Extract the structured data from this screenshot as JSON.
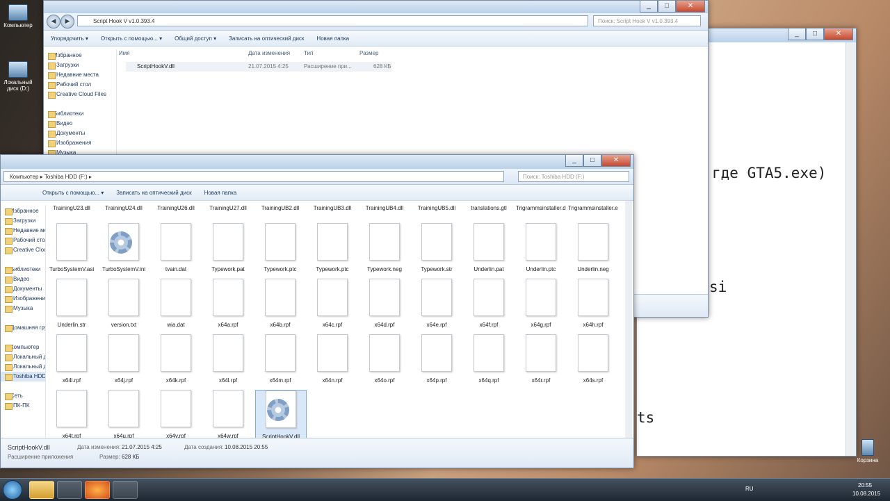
{
  "desktop": {
    "icons": [
      {
        "label": "Компьютер"
      },
      {
        "label": "Локальный диск (D:)"
      },
      {
        "label": "Корзина"
      }
    ]
  },
  "back_window": {
    "address": "Script Hook V v1.0.393.4",
    "search_placeholder": "Поиск: Script Hook V v1.0.393.4",
    "toolbar": [
      "Упорядочить ▾",
      "Открыть с помощью... ▾",
      "Общий доступ ▾",
      "Записать на оптический диск",
      "Новая папка"
    ],
    "tree": [
      "Избранное",
      "Загрузки",
      "Недавние места",
      "Рабочий стол",
      "Creative Cloud Files",
      "Библиотеки",
      "Видео",
      "Документы",
      "Изображения",
      "Музыка"
    ],
    "columns": {
      "name": "Имя",
      "date": "Дата изменения",
      "type": "Тип",
      "size": "Размер"
    },
    "file": {
      "name": "ScriptHookV.dll",
      "date": "21.07.2015 4:25",
      "type": "Расширение при...",
      "size": "628 КБ"
    }
  },
  "notepad_text": {
    "line1": "где GTA5.exe)",
    "line2": "si",
    "line3": "ts"
  },
  "front_window": {
    "breadcrumb": [
      "Компьютер",
      "Toshiba HDD (F:)"
    ],
    "search_placeholder": "Поиск: Toshiba HDD (F:)",
    "toolbar": [
      "Открыть с помощью... ▾",
      "Записать на оптический диск",
      "Новая папка"
    ],
    "tree": [
      "Избранное",
      "Загрузки",
      "Недавние места",
      "Рабочий стол",
      "Creative Cloud Files",
      "Библиотеки",
      "Видео",
      "Документы",
      "Изображения",
      "Музыка",
      "Домашняя группа",
      "Компьютер",
      "Локальный диск (C:)",
      "Локальный диск (D:)",
      "Toshiba HDD (F:)",
      "Сеть",
      "ПК-ПК"
    ],
    "top_row": [
      "TrainingU23.dll",
      "TrainingU24.dll",
      "TrainingU26.dll",
      "TrainingU27.dll",
      "TrainingUB2.dll",
      "TrainingUB3.dll",
      "TrainingUB4.dll",
      "TrainingUB5.dll",
      "translations.gtl",
      "Trigrammsinstaller.dlp",
      "Trigrammsinstaller.exe"
    ],
    "rows": [
      [
        "TurboSystemV.asi",
        "TurboSystemV.ini",
        "tvain.dat",
        "Typework.pat",
        "Typework.ptc",
        "Typework.ptc",
        "Typework.neg",
        "Typework.str",
        "Underlin.pat",
        "Underlin.ptc",
        "Underlin.neg"
      ],
      [
        "Underlin.str",
        "version.txt",
        "wia.dat",
        "x64a.rpf",
        "x64b.rpf",
        "x64c.rpf",
        "x64d.rpf",
        "x64e.rpf",
        "x64f.rpf",
        "x64g.rpf",
        "x64h.rpf"
      ],
      [
        "x64i.rpf",
        "x64j.rpf",
        "x64k.rpf",
        "x64l.rpf",
        "x64m.rpf",
        "x64n.rpf",
        "x64o.rpf",
        "x64p.rpf",
        "x64q.rpf",
        "x64r.rpf",
        "x64s.rpf"
      ],
      [
        "x64t.rpf",
        "x64u.rpf",
        "x64v.rpf",
        "x64w.rpf",
        "ScriptHookV.dll"
      ]
    ],
    "details": {
      "name": "ScriptHookV.dll",
      "kind": "Расширение приложения",
      "modified_label": "Дата изменения:",
      "modified": "21.07.2015 4:25",
      "size_label": "Размер:",
      "size": "628 КБ",
      "created_label": "Дата создания:",
      "created": "10.08.2015 20:55"
    }
  },
  "taskbar": {
    "lang": "RU",
    "time": "20:55",
    "date": "10.08.2015"
  }
}
